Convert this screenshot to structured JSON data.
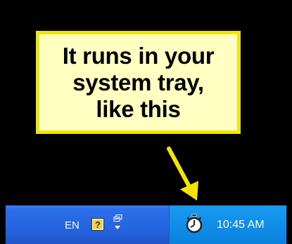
{
  "callout": {
    "lines": [
      "It runs in your",
      "system tray,",
      "like this"
    ]
  },
  "taskbar": {
    "language": "EN",
    "icons": [
      "help-icon",
      "network-icon"
    ]
  },
  "tray": {
    "icons": [
      "stopwatch-icon"
    ],
    "clock": "10:45 AM"
  },
  "colors": {
    "callout_background": "#ffffc2",
    "callout_border": "#f2e600",
    "arrow": "#f2e600",
    "taskbar": "#2664df",
    "tray": "#0f8ee8"
  }
}
